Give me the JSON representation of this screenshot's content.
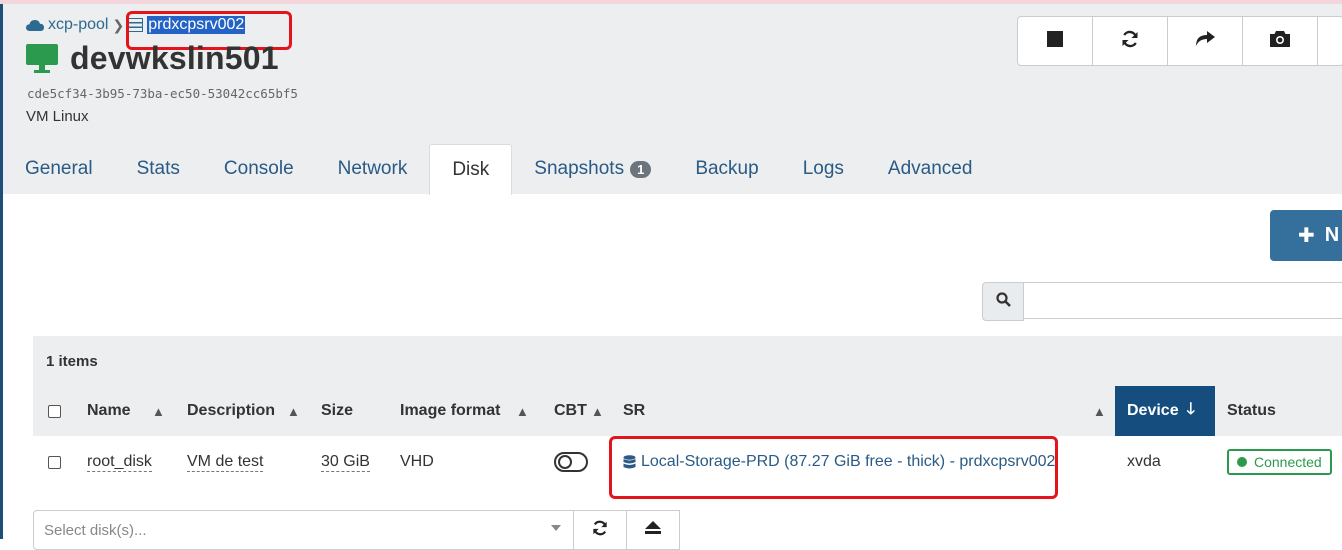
{
  "breadcrumb": {
    "pool": "xcp-pool",
    "host": "prdxcpsrv002"
  },
  "vm": {
    "name": "devwkslin501",
    "uuid": "cde5cf34-3b95-73ba-ec50-53042cc65bf5",
    "os": "VM Linux"
  },
  "actions": [
    {
      "icon": "stop-icon"
    },
    {
      "icon": "refresh-icon"
    },
    {
      "icon": "share-icon"
    },
    {
      "icon": "camera-icon"
    }
  ],
  "tabs": [
    {
      "label": "General"
    },
    {
      "label": "Stats"
    },
    {
      "label": "Console"
    },
    {
      "label": "Network"
    },
    {
      "label": "Disk",
      "active": true
    },
    {
      "label": "Snapshots",
      "badge": "1"
    },
    {
      "label": "Backup"
    },
    {
      "label": "Logs"
    },
    {
      "label": "Advanced"
    }
  ],
  "new_button": {
    "label": "N"
  },
  "table": {
    "items_count": "1 items",
    "columns": [
      "Name",
      "Description",
      "Size",
      "Image format",
      "CBT",
      "SR",
      "Device",
      "Status"
    ],
    "rows": [
      {
        "name": "root_disk",
        "description": "VM de test",
        "size": "30 GiB",
        "format": "VHD",
        "cbt": false,
        "sr": "Local-Storage-PRD (87.27 GiB free - thick) - prdxcpsrv002",
        "device": "xvda",
        "status": "Connected"
      }
    ]
  },
  "bottom": {
    "select_placeholder": "Select disk(s)..."
  },
  "colors": {
    "link": "#2a5a85",
    "device_header": "#144d7e",
    "connected": "#2b9a4e",
    "highlight": "#e3141c"
  }
}
